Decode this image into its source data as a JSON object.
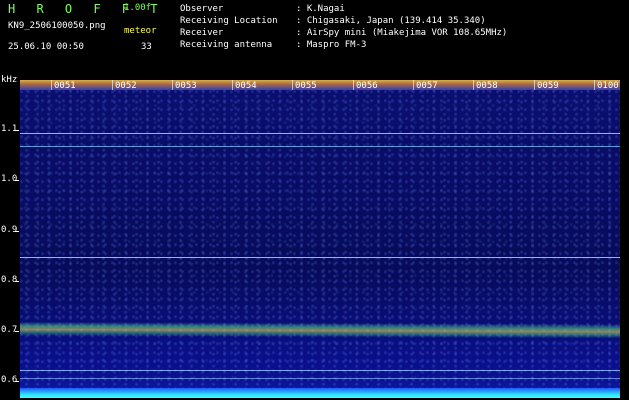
{
  "header": {
    "app": "H R O F F T",
    "version": "1.00f",
    "file": "KN9_2506100050.png",
    "meteor_label": "meteor",
    "datetime": "25.06.10 00:50",
    "count": "33",
    "info": [
      {
        "label": "Observer",
        "value": ": K.Nagai"
      },
      {
        "label": "Receiving Location",
        "value": ": Chigasaki, Japan (139.414 35.340)"
      },
      {
        "label": "Receiver",
        "value": ": AirSpy mini (Miakejima VOR 108.65MHz)"
      },
      {
        "label": "Receiving antenna",
        "value": ": Maspro FM-3"
      }
    ]
  },
  "axis": {
    "unit": "kHz",
    "ticks": [
      "1.1",
      "1.0",
      "0.9",
      "0.8",
      "0.7",
      "0.6"
    ]
  },
  "time_labels": [
    "0051",
    "0052",
    "0053",
    "0054",
    "0055",
    "0056",
    "0057",
    "0058",
    "0059",
    "0100"
  ],
  "colors": {
    "header_green": "#7cff5a",
    "header_yellow": "#ffff44",
    "tone": "#7fd6ff",
    "background": "#0a0e70"
  }
}
